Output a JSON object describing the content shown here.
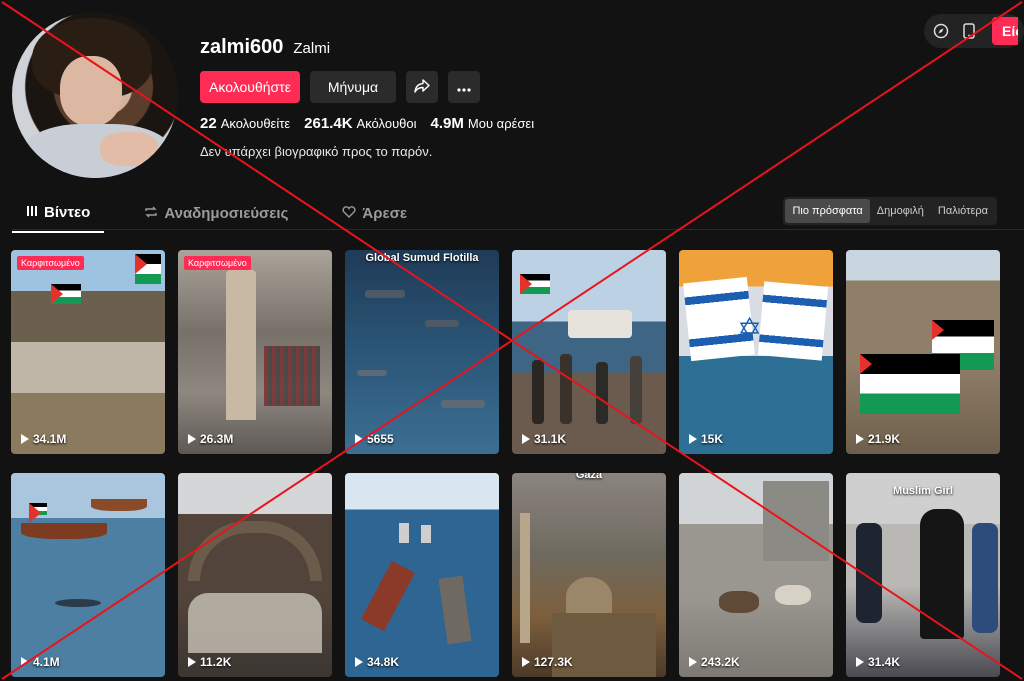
{
  "topbar": {
    "login_label": "Είσο"
  },
  "profile": {
    "username": "zalmi600",
    "nickname": "Zalmi",
    "follow_label": "Ακολουθήστε",
    "message_label": "Μήνυμα",
    "following_count": "22",
    "following_label": "Ακολουθείτε",
    "followers_count": "261.4K",
    "followers_label": "Ακόλουθοι",
    "likes_count": "4.9M",
    "likes_label": "Μου αρέσει",
    "bio": "Δεν υπάρχει βιογραφικό προς το παρόν."
  },
  "tabs": {
    "videos": "Βίντεο",
    "reposts": "Αναδημοσιεύσεις",
    "liked": "Άρεσε"
  },
  "sort": {
    "latest": "Πιο πρόσφατα",
    "popular": "Δημοφιλή",
    "oldest": "Παλιότερα"
  },
  "videos": [
    {
      "views": "34.1M",
      "pinned": "Καρφιτσωμένο",
      "caption": ""
    },
    {
      "views": "26.3M",
      "pinned": "Καρφιτσωμένο",
      "caption": ""
    },
    {
      "views": "5655",
      "pinned": "",
      "caption": "Global Sumud Flotilla"
    },
    {
      "views": "31.1K",
      "pinned": "",
      "caption": ""
    },
    {
      "views": "15K",
      "pinned": "",
      "caption": ""
    },
    {
      "views": "21.9K",
      "pinned": "",
      "caption": ""
    },
    {
      "views": "4.1M",
      "pinned": "",
      "caption": ""
    },
    {
      "views": "11.2K",
      "pinned": "",
      "caption": ""
    },
    {
      "views": "34.8K",
      "pinned": "",
      "caption": ""
    },
    {
      "views": "127.3K",
      "pinned": "",
      "caption": "Gaza"
    },
    {
      "views": "243.2K",
      "pinned": "",
      "caption": ""
    },
    {
      "views": "31.4K",
      "pinned": "",
      "caption": "Muslim Girl"
    }
  ],
  "colors": {
    "accent": "#fe2c55",
    "background": "#121212",
    "cross_overlay": "#e8141b"
  },
  "icons": [
    "compass-icon",
    "phone-icon",
    "share-icon",
    "more-icon",
    "grid-icon",
    "repost-icon",
    "heart-icon",
    "play-icon"
  ]
}
